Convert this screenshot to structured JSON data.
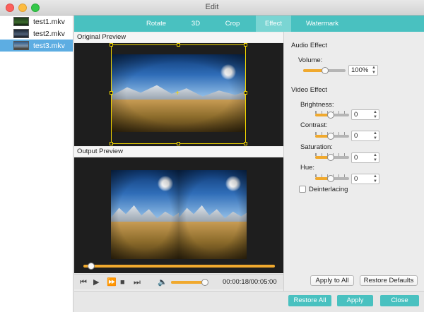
{
  "window": {
    "title": "Edit"
  },
  "files": [
    {
      "name": "test1.mkv",
      "selected": false,
      "thumb_icon": "green-video-thumbnail"
    },
    {
      "name": "test2.mkv",
      "selected": false,
      "thumb_icon": "dark-video-thumbnail"
    },
    {
      "name": "test3.mkv",
      "selected": true,
      "thumb_icon": "landscape-video-thumbnail"
    }
  ],
  "tabs": [
    {
      "label": "Rotate",
      "active": false
    },
    {
      "label": "3D",
      "active": false
    },
    {
      "label": "Crop",
      "active": false
    },
    {
      "label": "Effect",
      "active": true
    },
    {
      "label": "Watermark",
      "active": false
    }
  ],
  "preview": {
    "original_label": "Original Preview",
    "output_label": "Output Preview",
    "output_mode": "side-by-side 3D"
  },
  "player": {
    "time": "00:00:18/00:05:00",
    "progress_fraction": 0.04,
    "volume_fraction": 0.9,
    "icons": [
      "skip-back-icon",
      "play-icon",
      "fast-forward-icon",
      "stop-icon",
      "skip-end-icon",
      "speaker-icon"
    ]
  },
  "audio_effect": {
    "title": "Audio Effect",
    "volume_label": "Volume:",
    "volume_value": "100%",
    "volume_fraction": 0.5
  },
  "video_effect": {
    "title": "Video Effect",
    "controls": [
      {
        "label": "Brightness:",
        "value": "0",
        "fraction": 0.5
      },
      {
        "label": "Contrast:",
        "value": "0",
        "fraction": 0.5
      },
      {
        "label": "Saturation:",
        "value": "0",
        "fraction": 0.5
      },
      {
        "label": "Hue:",
        "value": "0",
        "fraction": 0.5
      }
    ],
    "deinterlacing_label": "Deinterlacing",
    "deinterlacing_checked": false
  },
  "actions": {
    "apply_to_all": "Apply to All",
    "restore_defaults": "Restore Defaults",
    "restore_all": "Restore All",
    "apply": "Apply",
    "close": "Close"
  },
  "colors": {
    "accent_teal": "#49c1c0",
    "active_tab": "#7ad5d3",
    "selection_blue": "#5dade2",
    "slider_orange": "#f0a92e",
    "crop_yellow": "#f2d600"
  }
}
